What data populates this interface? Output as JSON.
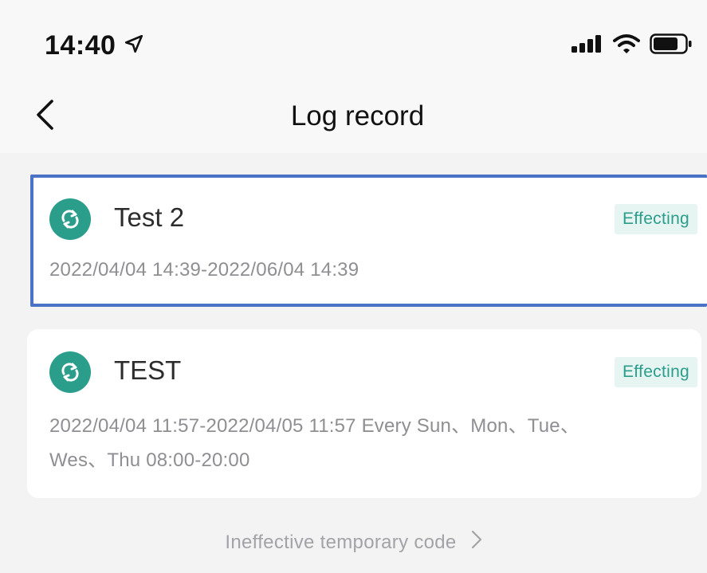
{
  "status_bar": {
    "time": "14:40",
    "icons": [
      "location-arrow-icon",
      "signal-icon",
      "wifi-icon",
      "battery-icon"
    ]
  },
  "header": {
    "title": "Log record",
    "back_icon": "chevron-left-icon"
  },
  "records": [
    {
      "name": "Test 2",
      "status": "Effecting",
      "period": "2022/04/04 14:39-2022/06/04 14:39",
      "icon": "refresh-icon",
      "selected": true
    },
    {
      "name": "TEST",
      "status": "Effecting",
      "period": "2022/04/04 11:57-2022/04/05 11:57 Every Sun、Mon、Tue、",
      "period_line2": "Wes、Thu 08:00-20:00",
      "icon": "refresh-icon",
      "selected": false
    }
  ],
  "footer": {
    "link_label": "Ineffective temporary code",
    "link_icon": "chevron-right-icon"
  },
  "colors": {
    "accent": "#2a9d8b",
    "badge_bg": "#e6f5f2",
    "selection_border": "#4a72c5",
    "background": "#f3f3f4"
  }
}
